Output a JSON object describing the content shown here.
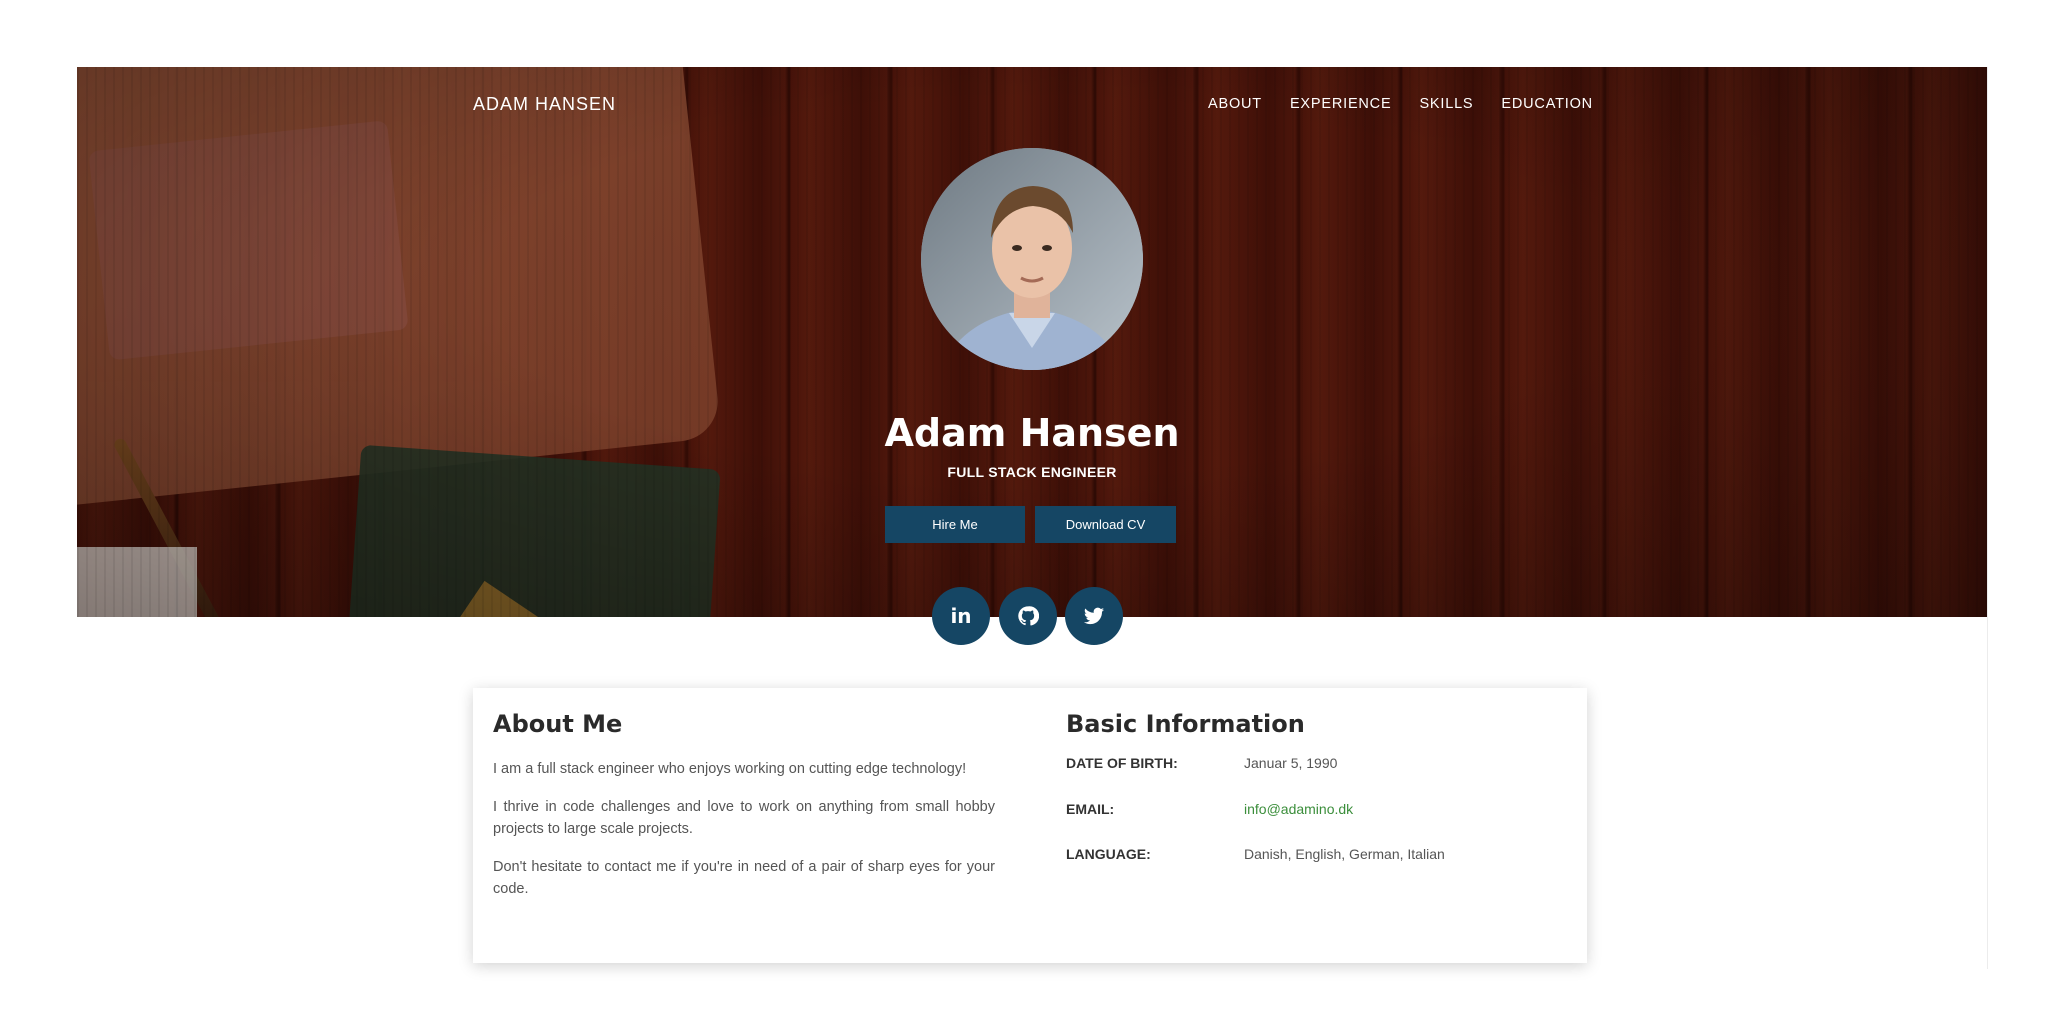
{
  "nav": {
    "brand": "ADAM HANSEN",
    "links": [
      "ABOUT",
      "EXPERIENCE",
      "SKILLS",
      "EDUCATION"
    ]
  },
  "hero": {
    "name": "Adam Hansen",
    "role": "FULL STACK ENGINEER",
    "buttons": {
      "hire": "Hire Me",
      "cv": "Download CV"
    },
    "social": [
      {
        "icon": "linkedin-icon",
        "label": "in"
      },
      {
        "icon": "github-icon"
      },
      {
        "icon": "twitter-icon"
      }
    ]
  },
  "about": {
    "title": "About Me",
    "paragraphs": [
      "I am a full stack engineer who enjoys working on cutting edge technology!",
      "I thrive in code challenges and love to work on anything from small hobby projects to large scale projects.",
      "Don't hesitate to contact me if you're in need of a pair of sharp eyes for your code."
    ]
  },
  "info": {
    "title": "Basic Information",
    "rows": [
      {
        "label": "DATE OF BIRTH:",
        "value": "Januar 5, 1990"
      },
      {
        "label": "EMAIL:",
        "value": "info@adamino.dk"
      },
      {
        "label": "LANGUAGE:",
        "value": "Danish, English, German, Italian"
      }
    ]
  },
  "colors": {
    "accent": "#154664",
    "link": "#3b8e3b"
  }
}
